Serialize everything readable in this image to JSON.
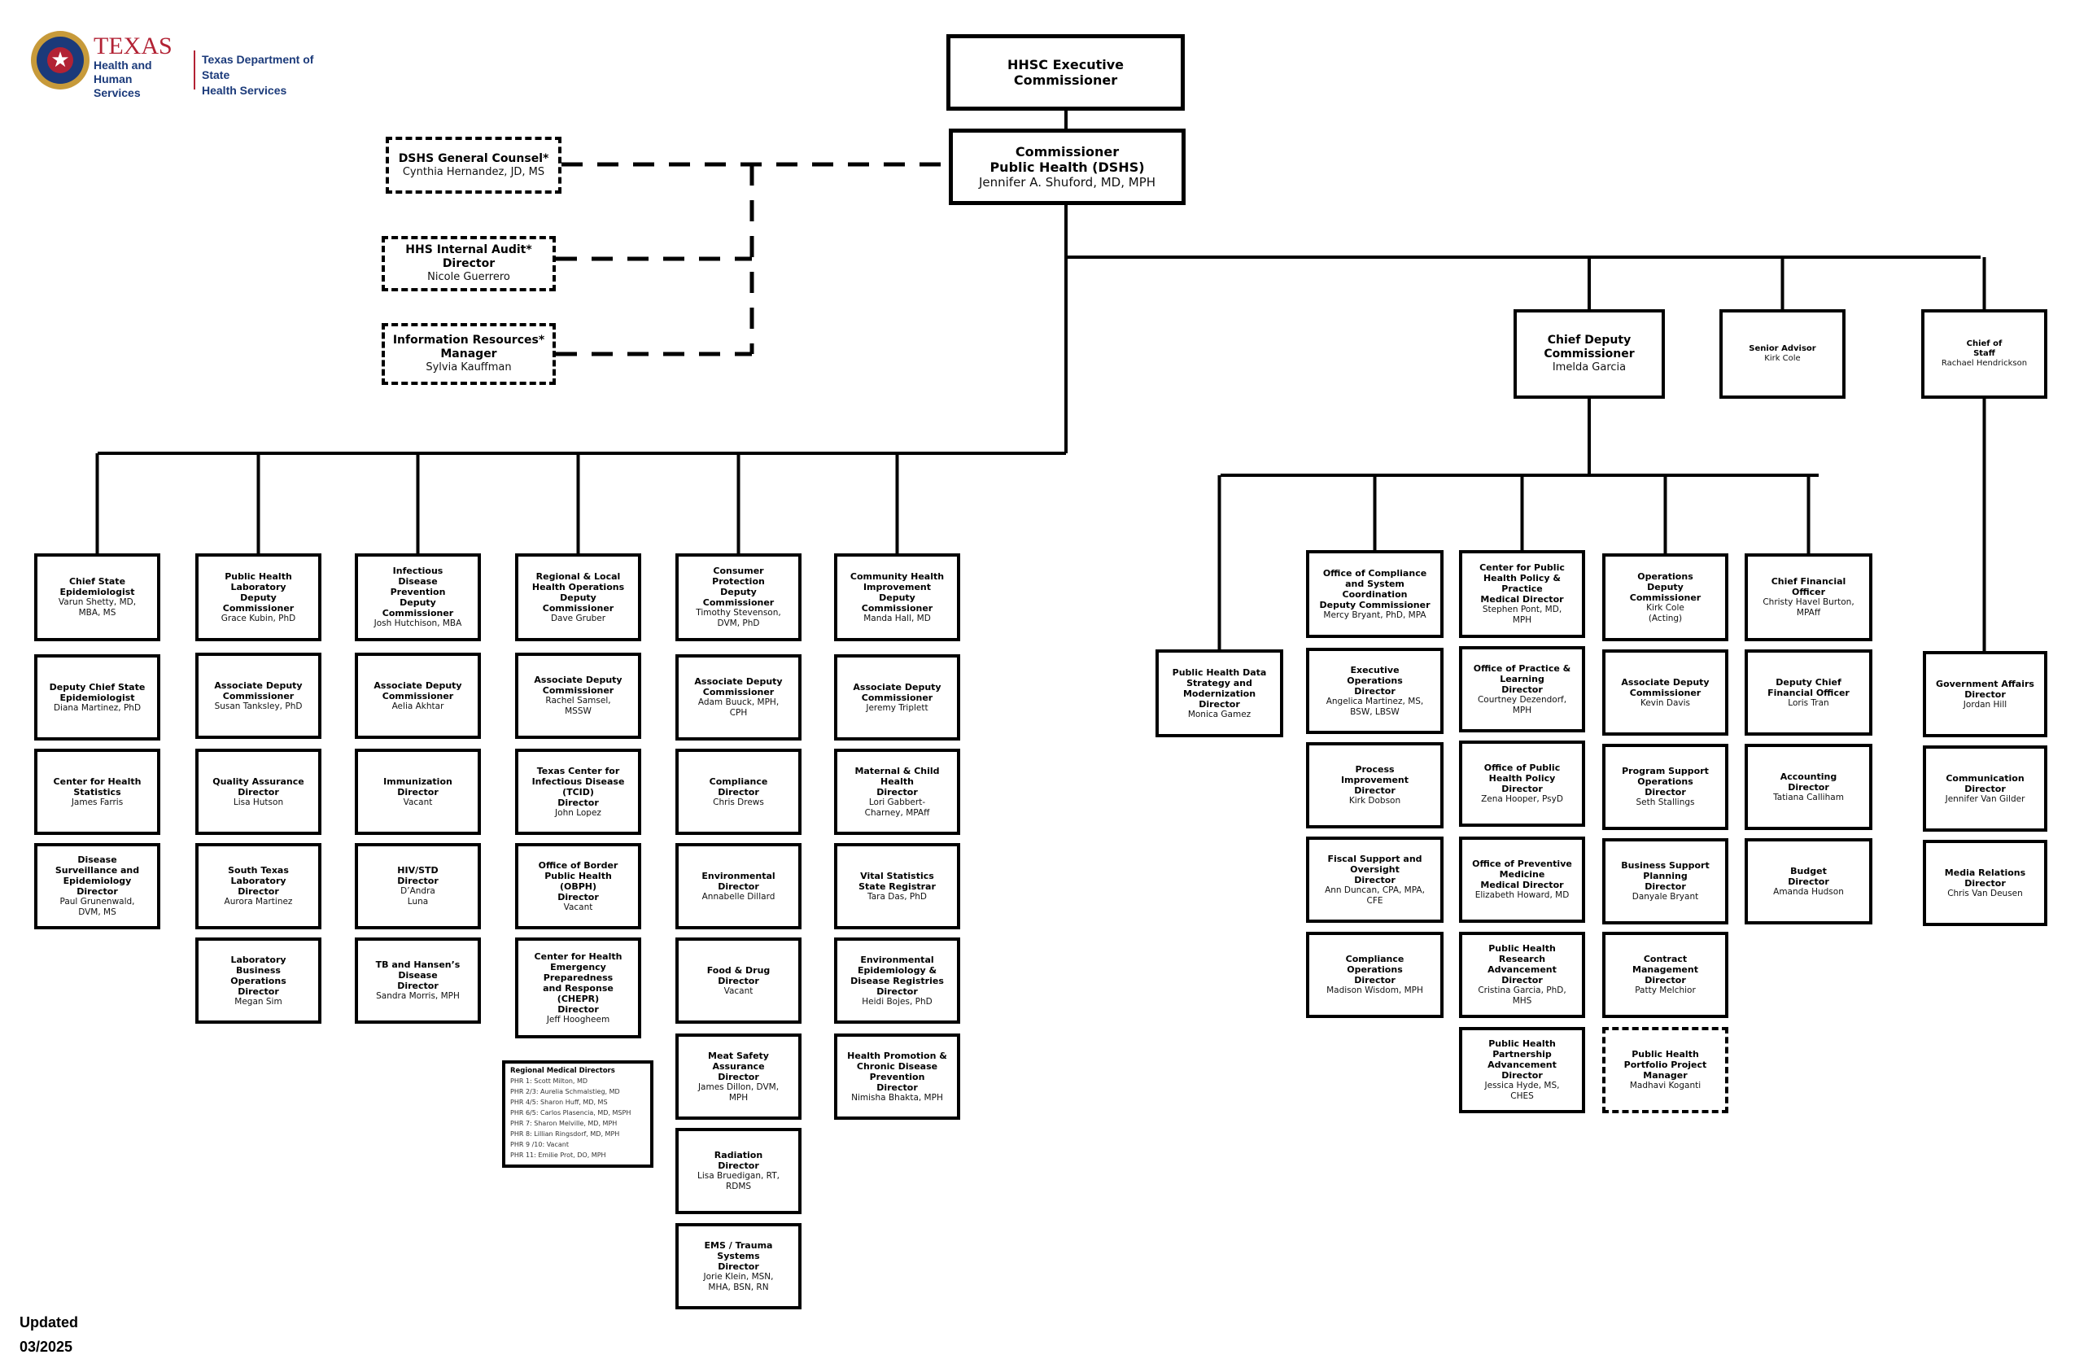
{
  "header": {
    "logo": {
      "seal_icon": "texas-star-seal",
      "texas": "TEXAS",
      "hhs": "Health and Human\nServices",
      "dshs": "Texas Department of State\nHealth Services"
    }
  },
  "colors": {
    "brand_red": "#b22234",
    "brand_blue": "#1b3a7a",
    "seal_gold": "#c79a3a",
    "line": "#000000"
  },
  "executive": [
    {
      "id": "hhsc",
      "title": "HHSC Executive\nCommissioner",
      "name": ""
    },
    {
      "id": "commissioner",
      "title": "Commissioner\nPublic Health (DSHS)",
      "name": "Jennifer A. Shuford, MD, MPH"
    }
  ],
  "dotted_line_reports": [
    {
      "id": "general-counsel",
      "title": "DSHS General Counsel*",
      "name": "Cynthia Hernandez, JD, MS"
    },
    {
      "id": "internal-audit",
      "title": "HHS Internal Audit*\nDirector",
      "name": "Nicole Guerrero"
    },
    {
      "id": "information-resources",
      "title": "Information Resources*\nManager",
      "name": "Sylvia Kauffman"
    }
  ],
  "direct_reports": [
    {
      "id": "chief-deputy",
      "title": "Chief Deputy\nCommissioner",
      "name": "Imelda Garcia"
    },
    {
      "id": "senior-advisor",
      "title": "Senior Advisor",
      "name": "Kirk Cole"
    },
    {
      "id": "chief-of-staff",
      "title": "Chief of\nStaff",
      "name": "Rachael Hendrickson"
    }
  ],
  "commissioner_divisions": [
    {
      "head": {
        "title": "Chief State\nEpidemiologist",
        "name": "Varun Shetty, MD,\nMBA, MS"
      },
      "units": [
        {
          "title": "Deputy Chief State\nEpidemiologist",
          "name": "Diana Martinez, PhD"
        },
        {
          "title": "Center for Health\nStatistics",
          "name": "James Farris"
        },
        {
          "title": "Disease\nSurveillance and\nEpidemiology\nDirector",
          "name": "Paul Grunenwald,\nDVM, MS"
        }
      ]
    },
    {
      "head": {
        "title": "Public Health\nLaboratory\nDeputy\nCommissioner",
        "name": "Grace Kubin, PhD"
      },
      "units": [
        {
          "title": "Associate Deputy\nCommissioner",
          "name": "Susan Tanksley, PhD"
        },
        {
          "title": "Quality Assurance\nDirector",
          "name": "Lisa Hutson"
        },
        {
          "title": "South Texas\nLaboratory\nDirector",
          "name": "Aurora Martinez"
        },
        {
          "title": "Laboratory\nBusiness\nOperations\nDirector",
          "name": "Megan Sim"
        }
      ]
    },
    {
      "head": {
        "title": "Infectious\nDisease\nPrevention\nDeputy\nCommissioner",
        "name": "Josh Hutchison, MBA"
      },
      "units": [
        {
          "title": "Associate Deputy\nCommissioner",
          "name": "Aelia Akhtar"
        },
        {
          "title": "Immunization\nDirector",
          "name": "Vacant"
        },
        {
          "title": "HIV/STD\nDirector",
          "name": "D’Andra\nLuna"
        },
        {
          "title": "TB and Hansen’s\nDisease\nDirector",
          "name": "Sandra Morris, MPH"
        }
      ]
    },
    {
      "head": {
        "title": "Regional & Local\nHealth Operations\nDeputy\nCommissioner",
        "name": "Dave Gruber"
      },
      "units": [
        {
          "title": "Associate Deputy\nCommissioner",
          "name": "Rachel Samsel,\nMSSW"
        },
        {
          "title": "Texas Center for\nInfectious Disease\n(TCID)\nDirector",
          "name": "John Lopez"
        },
        {
          "title": "Office of Border\nPublic Health\n(OBPH)\nDirector",
          "name": "Vacant"
        },
        {
          "title": "Center for Health\nEmergency\nPreparedness\nand Response\n(CHEPR)\nDirector",
          "name": "Jeff Hoogheem"
        }
      ]
    },
    {
      "head": {
        "title": "Consumer\nProtection\nDeputy\nCommissioner",
        "name": "Timothy Stevenson,\nDVM, PhD"
      },
      "units": [
        {
          "title": "Associate Deputy\nCommissioner",
          "name": "Adam Buuck, MPH,\nCPH"
        },
        {
          "title": "Compliance\nDirector",
          "name": "Chris Drews"
        },
        {
          "title": "Environmental\nDirector",
          "name": "Annabelle Dillard"
        },
        {
          "title": "Food & Drug\nDirector",
          "name": "Vacant"
        },
        {
          "title": "Meat Safety\nAssurance\nDirector",
          "name": "James Dillon, DVM,\nMPH"
        },
        {
          "title": "Radiation\nDirector",
          "name": "Lisa Bruedigan, RT,\nRDMS"
        },
        {
          "title": "EMS / Trauma\nSystems\nDirector",
          "name": "Jorie Klein, MSN,\nMHA, BSN, RN"
        }
      ]
    },
    {
      "head": {
        "title": "Community Health\nImprovement\nDeputy\nCommissioner",
        "name": "Manda Hall, MD"
      },
      "units": [
        {
          "title": "Associate Deputy\nCommissioner",
          "name": "Jeremy Triplett"
        },
        {
          "title": "Maternal & Child\nHealth\nDirector",
          "name": "Lori Gabbert-\nCharney, MPAff"
        },
        {
          "title": "Vital Statistics\nState Registrar",
          "name": "Tara Das, PhD"
        },
        {
          "title": "Environmental\nEpidemiology &\nDisease Registries\nDirector",
          "name": "Heidi Bojes, PhD"
        },
        {
          "title": "Health Promotion &\nChronic Disease\nPrevention\nDirector",
          "name": "Nimisha Bhakta, MPH"
        }
      ]
    }
  ],
  "regional_medical_directors": {
    "heading": "Regional Medical Directors",
    "rows": [
      "PHR 1:  Scott Milton, MD",
      "PHR 2/3:  Aurelia Schmalstieg, MD",
      "PHR 4/5:  Sharon Huff, MD, MS",
      "PHR 6/5:  Carlos Plasencia, MD, MSPH",
      "PHR 7:  Sharon Melville, MD, MPH",
      "PHR 8:  Lillian Ringsdorf, MD, MPH",
      "PHR 9 /10:  Vacant",
      "PHR 11:  Emilie Prot, DO, MPH"
    ]
  },
  "chief_deputy_divisions": [
    {
      "head": {
        "title": "Public Health Data\nStrategy and\nModernization\nDirector",
        "name": "Monica Gamez"
      },
      "units": []
    },
    {
      "head": {
        "title": "Office of Compliance\nand System\nCoordination\nDeputy Commissioner",
        "name": "Mercy Bryant, PhD, MPA"
      },
      "units": [
        {
          "title": "Executive\nOperations\nDirector",
          "name": "Angelica Martinez, MS,\nBSW, LBSW"
        },
        {
          "title": "Process\nImprovement\nDirector",
          "name": "Kirk Dobson"
        },
        {
          "title": "Fiscal Support and\nOversight\nDirector",
          "name": "Ann Duncan, CPA, MPA,\nCFE"
        },
        {
          "title": "Compliance\nOperations\nDirector",
          "name": "Madison Wisdom, MPH"
        }
      ]
    },
    {
      "head": {
        "title": "Center for Public\nHealth Policy &\nPractice\nMedical Director",
        "name": "Stephen Pont, MD,\nMPH"
      },
      "units": [
        {
          "title": "Office of Practice &\nLearning\nDirector",
          "name": "Courtney Dezendorf,\nMPH"
        },
        {
          "title": "Office of Public\nHealth Policy\nDirector",
          "name": "Zena Hooper, PsyD"
        },
        {
          "title": "Office of Preventive\nMedicine\nMedical Director",
          "name": "Elizabeth Howard, MD"
        },
        {
          "title": "Public Health\nResearch\nAdvancement\nDirector",
          "name": "Cristina Garcia, PhD,\nMHS"
        },
        {
          "title": "Public Health\nPartnership\nAdvancement\nDirector",
          "name": "Jessica Hyde, MS,\nCHES"
        }
      ]
    },
    {
      "head": {
        "title": "Operations\nDeputy\nCommissioner",
        "name": "Kirk Cole\n(Acting)"
      },
      "units": [
        {
          "title": "Associate Deputy\nCommissioner",
          "name": "Kevin Davis"
        },
        {
          "title": "Program Support\nOperations\nDirector",
          "name": "Seth Stallings"
        },
        {
          "title": "Business Support\nPlanning\nDirector",
          "name": "Danyale Bryant"
        },
        {
          "title": "Contract\nManagement\nDirector",
          "name": "Patty Melchior"
        },
        {
          "title": "Public Health\nPortfolio Project\nManager",
          "name": "Madhavi Koganti",
          "dashed": true
        }
      ]
    },
    {
      "head": {
        "title": "Chief Financial\nOfficer",
        "name": "Christy Havel Burton,\nMPAff"
      },
      "units": [
        {
          "title": "Deputy Chief\nFinancial Officer",
          "name": "Loris Tran"
        },
        {
          "title": "Accounting\nDirector",
          "name": "Tatiana Calliham"
        },
        {
          "title": "Budget\nDirector",
          "name": "Amanda Hudson"
        }
      ]
    }
  ],
  "chief_of_staff_units": [
    {
      "title": "Government Affairs\nDirector",
      "name": "Jordan Hill"
    },
    {
      "title": "Communication\nDirector",
      "name": "Jennifer Van Gilder"
    },
    {
      "title": "Media Relations\nDirector",
      "name": "Chris Van Deusen"
    }
  ],
  "footer": {
    "updated": "Updated\n03/2025"
  }
}
